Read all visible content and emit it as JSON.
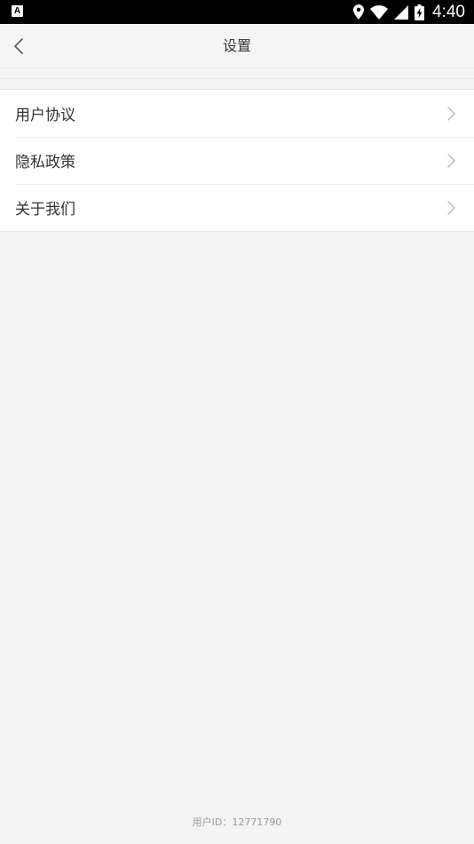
{
  "status_bar": {
    "left_icon": "A",
    "time": "4:40",
    "icons": [
      "location-icon",
      "wifi-icon",
      "signal-icon",
      "battery-charging-icon"
    ]
  },
  "nav": {
    "title": "设置",
    "back_icon": "chevron-left-icon"
  },
  "menu": {
    "items": [
      {
        "label": "用户协议",
        "icon": "chevron-right-icon"
      },
      {
        "label": "隐私政策",
        "icon": "chevron-right-icon"
      },
      {
        "label": "关于我们",
        "icon": "chevron-right-icon"
      }
    ]
  },
  "footer": {
    "user_id_text": "用户ID：12771790"
  },
  "colors": {
    "background": "#f4f4f4",
    "card": "#ffffff",
    "text_primary": "#333333",
    "text_muted": "#999999",
    "chevron": "#bbbbbb"
  }
}
